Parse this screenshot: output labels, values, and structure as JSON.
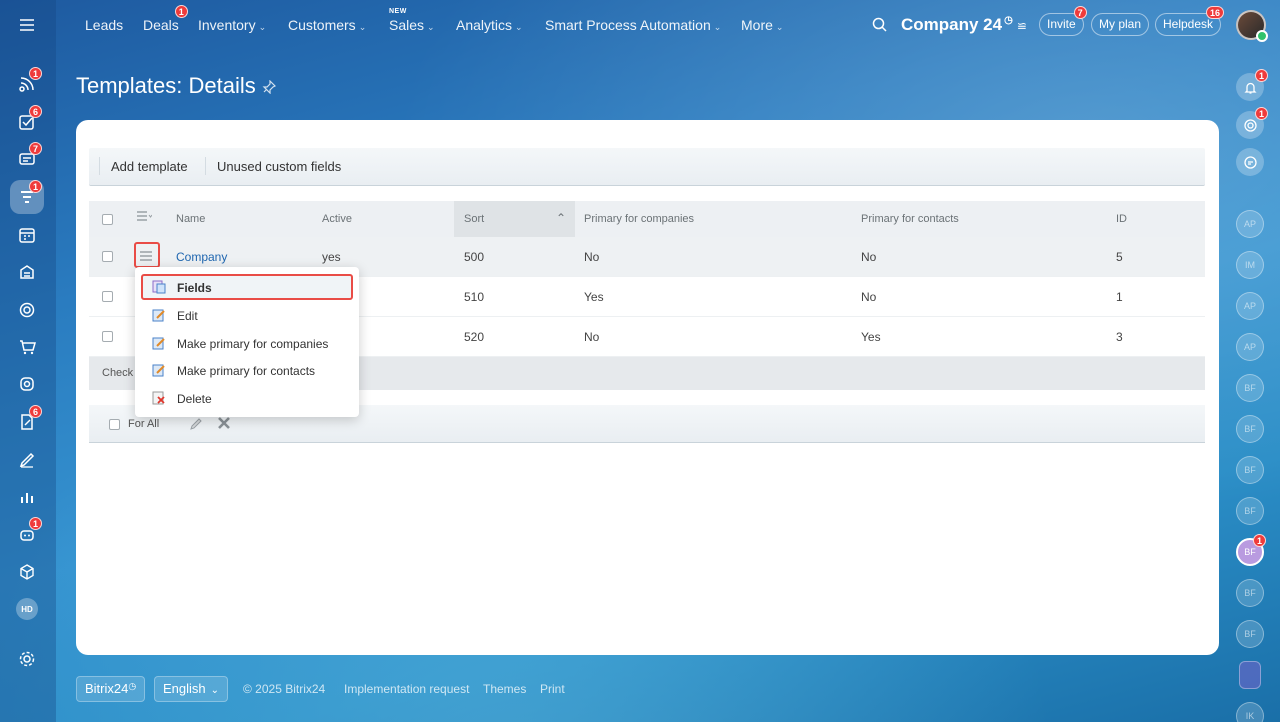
{
  "topnav": {
    "menu_icon": "hamburger-icon",
    "items": [
      {
        "label": "Leads"
      },
      {
        "label": "Deals",
        "badge": "1"
      },
      {
        "label": "Inventory"
      },
      {
        "label": "Customers"
      },
      {
        "label": "Sales",
        "tag": "NEW"
      },
      {
        "label": "Analytics"
      },
      {
        "label": "Smart Process Automation"
      },
      {
        "label": "More"
      }
    ],
    "company": "Company 24",
    "invite": {
      "label": "Invite",
      "badge": "7"
    },
    "my_plan": "My plan",
    "helpdesk": {
      "label": "Helpdesk",
      "badge": "16"
    }
  },
  "left_sidebar": {
    "badges": {
      "feed": "1",
      "tasks": "6",
      "chat": "7",
      "crm": "1",
      "docs": "6",
      "robot": "1"
    },
    "hd_label": "HD"
  },
  "page": {
    "title": "Templates: Details"
  },
  "toolbar": {
    "add_template": "Add template",
    "unused_fields": "Unused custom fields"
  },
  "grid": {
    "columns": [
      "Name",
      "Active",
      "Sort",
      "Primary for companies",
      "Primary for contacts",
      "ID"
    ],
    "rows": [
      {
        "name": "Company",
        "active": "yes",
        "sort": "500",
        "primary_companies": "No",
        "primary_contacts": "No",
        "id": "5"
      },
      {
        "name": "",
        "active": "",
        "sort": "510",
        "primary_companies": "Yes",
        "primary_contacts": "No",
        "id": "1"
      },
      {
        "name": "",
        "active": "",
        "sort": "520",
        "primary_companies": "No",
        "primary_contacts": "Yes",
        "id": "3"
      }
    ],
    "footer_text": "Check",
    "for_all": "For All"
  },
  "context_menu": {
    "items": [
      {
        "label": "Fields",
        "highlighted": true
      },
      {
        "label": "Edit"
      },
      {
        "label": "Make primary for companies"
      },
      {
        "label": "Make primary for contacts"
      },
      {
        "label": "Delete"
      }
    ]
  },
  "right_bar": {
    "notify_badge": "1",
    "pulse_badge": "1",
    "avatars": [
      "AP",
      "IM",
      "AP",
      "AP",
      "BF",
      "BF",
      "BF",
      "BF",
      "BF",
      "BF",
      "BF",
      "",
      "IK"
    ],
    "active_avatar_badge": "1"
  },
  "footer": {
    "brand": "Bitrix24",
    "language": "English",
    "copyright": "© 2025 Bitrix24",
    "implementation": "Implementation request",
    "themes": "Themes",
    "print": "Print"
  }
}
